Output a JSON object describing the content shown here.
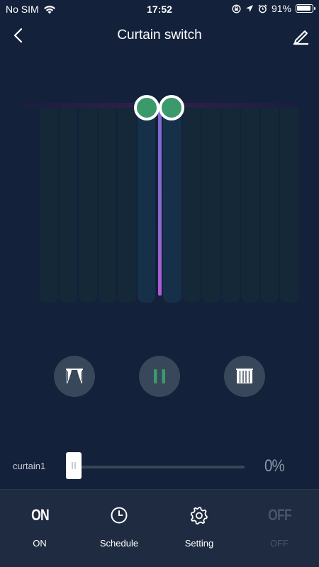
{
  "status_bar": {
    "carrier": "No SIM",
    "time": "17:52",
    "battery": "91%"
  },
  "header": {
    "title": "Curtain switch"
  },
  "curtain": {
    "position_percent": 0
  },
  "slider": {
    "label": "curtain1",
    "value": "0%"
  },
  "controls": {
    "open_icon": "curtain-open-icon",
    "pause_icon": "pause-icon",
    "close_icon": "curtain-close-icon"
  },
  "tabs": [
    {
      "icon_text": "ON",
      "label": "ON"
    },
    {
      "icon": "clock-icon",
      "label": "Schedule"
    },
    {
      "icon": "gear-icon",
      "label": "Setting"
    },
    {
      "icon_text": "OFF",
      "label": "OFF"
    }
  ],
  "colors": {
    "background": "#13213a",
    "accent_green": "#3b9a6c",
    "divider_purple": "#8a6ac8",
    "disabled": "#4a5568"
  }
}
